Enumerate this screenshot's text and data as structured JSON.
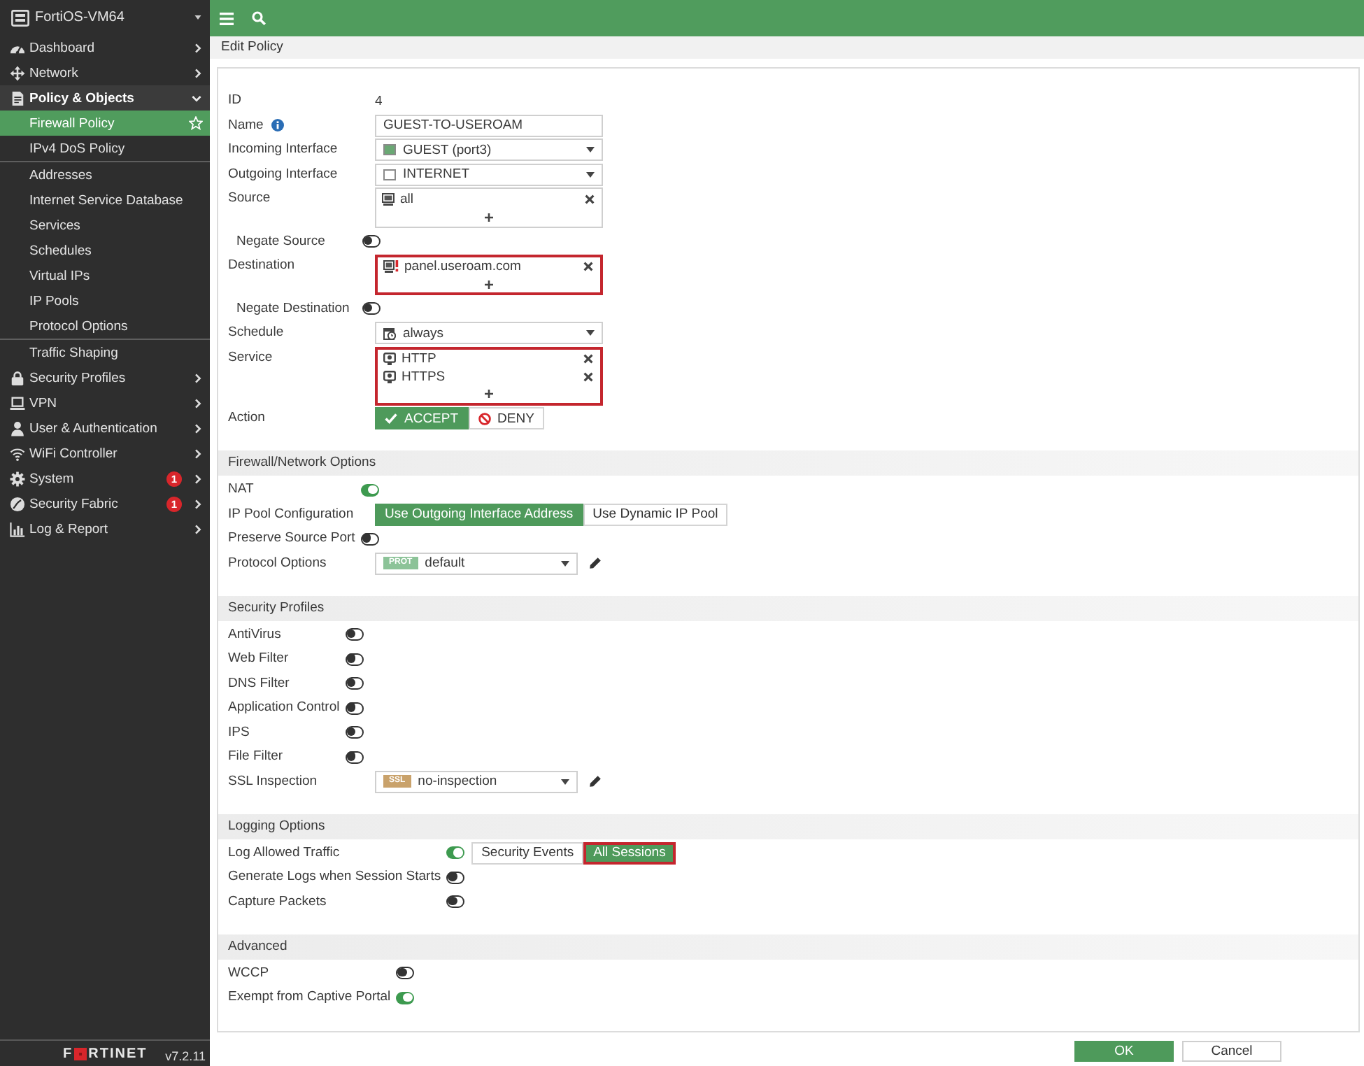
{
  "sidebar": {
    "device": "FortiOS-VM64",
    "items": [
      {
        "label": "Dashboard",
        "expanded": false
      },
      {
        "label": "Network",
        "expanded": false
      },
      {
        "label": "Policy & Objects",
        "expanded": true,
        "child_groups": [
          {
            "children": [
              {
                "label": "Firewall Policy",
                "selected": true
              },
              {
                "label": "IPv4 DoS Policy",
                "selected": false
              }
            ]
          },
          {
            "children": [
              {
                "label": "Addresses",
                "selected": false
              },
              {
                "label": "Internet Service Database",
                "selected": false
              },
              {
                "label": "Services",
                "selected": false
              },
              {
                "label": "Schedules",
                "selected": false
              },
              {
                "label": "Virtual IPs",
                "selected": false
              },
              {
                "label": "IP Pools",
                "selected": false
              },
              {
                "label": "Protocol Options",
                "selected": false
              }
            ]
          },
          {
            "children": [
              {
                "label": "Traffic Shaping",
                "selected": false
              }
            ]
          }
        ]
      },
      {
        "label": "Security Profiles",
        "expanded": false
      },
      {
        "label": "VPN",
        "expanded": false
      },
      {
        "label": "User & Authentication",
        "expanded": false
      },
      {
        "label": "WiFi Controller",
        "expanded": false
      },
      {
        "label": "System",
        "expanded": false,
        "badge": "1"
      },
      {
        "label": "Security Fabric",
        "expanded": false,
        "badge": "1"
      },
      {
        "label": "Log & Report",
        "expanded": false
      }
    ],
    "logo": {
      "lead": "F",
      "rest": "RTINET"
    },
    "version": "v7.2.11"
  },
  "page_title": "Edit Policy",
  "sections": [
    {
      "rows": [
        {
          "kind": "text",
          "label": "ID",
          "value": "4"
        },
        {
          "kind": "input",
          "label": "Name",
          "info": true,
          "value": "GUEST-TO-USEROAM"
        },
        {
          "kind": "interface_select",
          "label": "Incoming Interface",
          "color": "#6aa874",
          "value": "GUEST (port3)"
        },
        {
          "kind": "interface_select",
          "label": "Outgoing Interface",
          "color": "#ffffff",
          "value": "INTERNET"
        },
        {
          "kind": "address_list",
          "label": "Source",
          "highlighted": false,
          "entries": [
            {
              "kind": "address",
              "label": "all"
            }
          ]
        },
        {
          "kind": "sub_toggle",
          "label": "Negate Source",
          "on": false
        },
        {
          "kind": "address_list",
          "label": "Destination",
          "highlighted": true,
          "entries": [
            {
              "kind": "fqdn",
              "label": "panel.useroam.com"
            }
          ]
        },
        {
          "kind": "sub_toggle",
          "label": "Negate Destination",
          "on": false
        },
        {
          "kind": "schedule_select",
          "label": "Schedule",
          "value": "always"
        },
        {
          "kind": "address_list",
          "label": "Service",
          "highlighted": true,
          "entries": [
            {
              "kind": "service",
              "label": "HTTP"
            },
            {
              "kind": "service",
              "label": "HTTPS"
            }
          ]
        },
        {
          "kind": "choice",
          "label": "Action",
          "options": [
            {
              "kind": "accept",
              "label": "ACCEPT",
              "selected": true
            },
            {
              "kind": "deny",
              "label": "DENY",
              "selected": false
            }
          ]
        }
      ]
    },
    {
      "title": "Firewall/Network Options",
      "rows": [
        {
          "kind": "toggle",
          "label": "NAT",
          "on": true
        },
        {
          "kind": "segmented",
          "label": "IP Pool Configuration",
          "options": [
            {
              "label": "Use Outgoing Interface Address",
              "selected": true,
              "highlighted": false
            },
            {
              "label": "Use Dynamic IP Pool",
              "selected": false,
              "highlighted": false
            }
          ]
        },
        {
          "kind": "toggle",
          "label": "Preserve Source Port",
          "on": false
        },
        {
          "kind": "profile_select",
          "label": "Protocol Options",
          "tag": "PROT",
          "color": "#8cc398",
          "value": "default"
        }
      ]
    },
    {
      "title": "Security Profiles",
      "rows": [
        {
          "kind": "toggle",
          "label": "AntiVirus",
          "on": false
        },
        {
          "kind": "toggle",
          "label": "Web Filter",
          "on": false
        },
        {
          "kind": "toggle",
          "label": "DNS Filter",
          "on": false
        },
        {
          "kind": "toggle",
          "label": "Application Control",
          "on": false
        },
        {
          "kind": "toggle",
          "label": "IPS",
          "on": false
        },
        {
          "kind": "toggle",
          "label": "File Filter",
          "on": false
        },
        {
          "kind": "profile_select",
          "label": "SSL Inspection",
          "tag": "SSL",
          "color": "#c9a26b",
          "value": "no-inspection"
        }
      ]
    },
    {
      "title": "Logging Options",
      "rows": [
        {
          "kind": "toggle",
          "label": "Log Allowed Traffic",
          "on": true,
          "options": [
            {
              "label": "Security Events",
              "selected": false,
              "highlighted": false
            },
            {
              "label": "All Sessions",
              "selected": true,
              "highlighted": true
            }
          ]
        },
        {
          "kind": "toggle",
          "label": "Generate Logs when Session Starts",
          "on": false
        },
        {
          "kind": "toggle",
          "label": "Capture Packets",
          "on": false
        }
      ]
    },
    {
      "title": "Advanced",
      "rows": [
        {
          "kind": "toggle",
          "label": "WCCP",
          "on": false
        },
        {
          "kind": "toggle",
          "label": "Exempt from Captive Portal",
          "on": true
        }
      ]
    }
  ],
  "buttons": [
    {
      "label": "OK",
      "kind": "primary"
    },
    {
      "label": "Cancel",
      "kind": "secondary"
    }
  ]
}
